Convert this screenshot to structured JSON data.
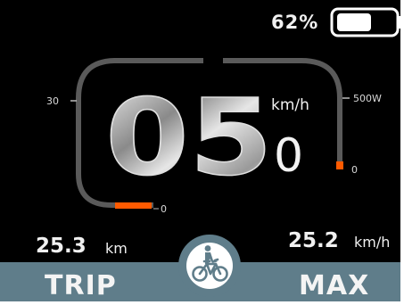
{
  "battery": {
    "percent_text": "62%",
    "level": 0.62,
    "color": "#ffffff"
  },
  "speed": {
    "main_digits": "05",
    "decimal_digit": "0",
    "unit": "km/h"
  },
  "scales": {
    "speed_tick_label": "30",
    "speed_zero_label": "0",
    "power_tick_label": "500W",
    "power_zero_label": "0"
  },
  "trip": {
    "distance_value": "25.3",
    "distance_unit": "km"
  },
  "max": {
    "speed_value": "25.2",
    "speed_unit": "km/h"
  },
  "modes": {
    "left_label": "TRIP",
    "right_label": "MAX"
  },
  "icons": {
    "center_badge": "bicycle-rider-icon",
    "battery": "battery-icon"
  },
  "colors": {
    "accent": "#ff5a00",
    "gauge_track": "#5a5a5a",
    "bar": "#5f7d8a",
    "text": "#e8e8e8"
  }
}
